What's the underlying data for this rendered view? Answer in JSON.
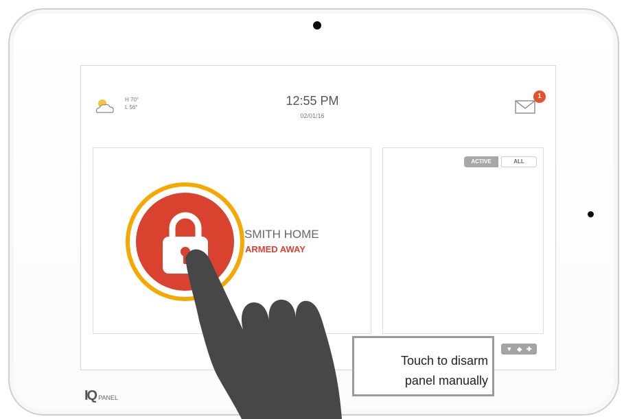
{
  "device": {
    "logo": {
      "mark": "IQ",
      "text": "PANEL"
    }
  },
  "header": {
    "weather": {
      "high": "H 70°",
      "low": "L 56°",
      "icon": "partly-cloudy-icon"
    },
    "time": "12:55 PM",
    "date": "02/01/16",
    "messages": {
      "icon": "mail-icon",
      "count": "1"
    }
  },
  "security": {
    "home_name": "SMITH HOME",
    "status": "ARMED AWAY",
    "icon": "lock-icon"
  },
  "events": {
    "filter_active": "ACTIVE",
    "filter_all": "ALL",
    "controls": [
      "▼",
      "◆",
      "✚"
    ]
  },
  "callout": {
    "line1": "Touch to disarm",
    "line2": "panel manually"
  },
  "colors": {
    "armed_red": "#d8422e",
    "ring_gold": "#f5a800",
    "badge_orange": "#e8502a",
    "hand_gray": "#4a4a4a"
  }
}
